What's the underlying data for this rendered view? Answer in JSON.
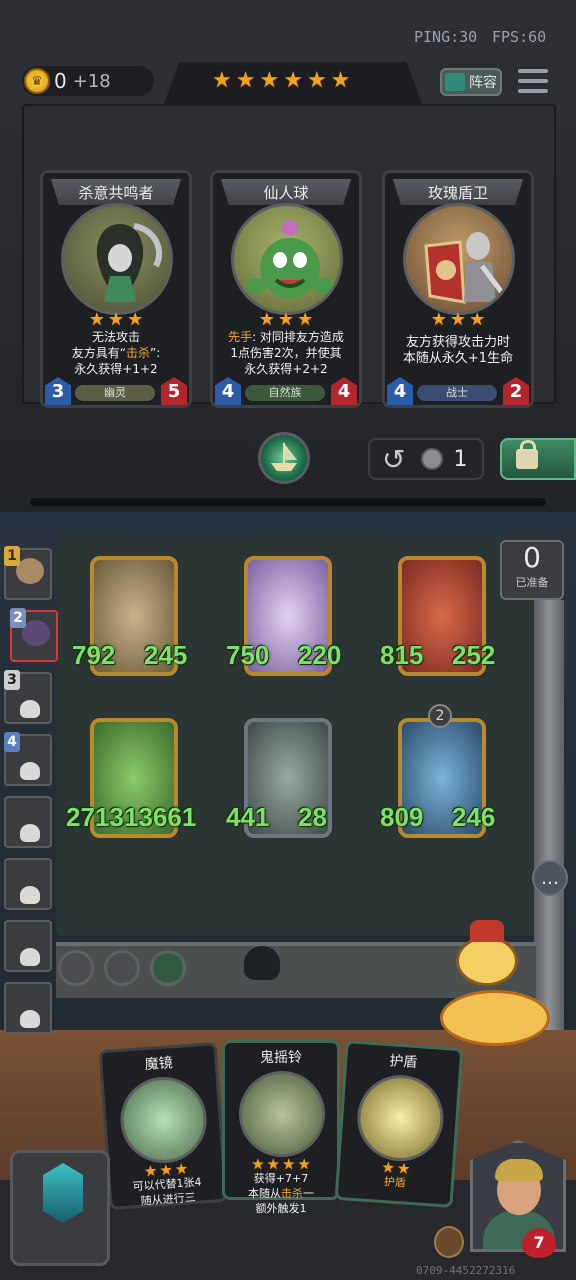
{
  "status": {
    "ping": "PING:30",
    "fps": "FPS:60"
  },
  "gold": {
    "value": "0",
    "income": "+18"
  },
  "tavern": {
    "tier_stars": 6
  },
  "lineup_button": "阵容",
  "shop": [
    {
      "name": "杀意共鸣者",
      "stars": 3,
      "text_parts": [
        "无法攻击",
        "友方具有“",
        "击杀",
        "”:",
        "永久获得+1+2"
      ],
      "tribe": "幽灵",
      "attack": "3",
      "health": "5"
    },
    {
      "name": "仙人球",
      "stars": 3,
      "text_parts": [
        "先手",
        ": 对同排友方造成",
        "1点伤害2次，并使其",
        "永久获得+2+2"
      ],
      "tribe": "自然族",
      "attack": "4",
      "health": "4"
    },
    {
      "name": "玫瑰盾卫",
      "stars": 3,
      "text_parts": [
        "友方获得攻击力时",
        "本随从永久+1生命"
      ],
      "tribe": "战士",
      "attack": "4",
      "health": "2"
    }
  ],
  "refresh": {
    "cost": "1"
  },
  "ready": {
    "count": "0",
    "label": "已准备"
  },
  "rankings": [
    {
      "rank": "1"
    },
    {
      "rank": "2"
    },
    {
      "rank": "3"
    },
    {
      "rank": "4"
    },
    {
      "rank": ""
    },
    {
      "rank": ""
    },
    {
      "rank": ""
    },
    {
      "rank": ""
    }
  ],
  "board": [
    {
      "attack": "792",
      "health": "245"
    },
    {
      "attack": "750",
      "health": "220"
    },
    {
      "attack": "815",
      "health": "252"
    },
    {
      "attack": "2713",
      "health": "13661"
    },
    {
      "attack": "441",
      "health": "28"
    },
    {
      "attack": "809",
      "health": "246",
      "badge": "2"
    }
  ],
  "hand": [
    {
      "name": "魔镜",
      "stars": 3,
      "text_parts": [
        "可以代替1张4",
        "随从进行三"
      ]
    },
    {
      "name": "鬼摇铃",
      "stars": 4,
      "text_parts": [
        "获得+7+7",
        "本随从",
        "击杀",
        "一",
        "额外触发1"
      ]
    },
    {
      "name": "护盾",
      "stars": 2,
      "text_parts": [
        "护盾"
      ]
    }
  ],
  "hero": {
    "health": "7"
  },
  "game_id": "0709-4452272316",
  "colors": {
    "star": "#f4a21c",
    "stat_green": "#7fe06b",
    "attack_badge": "#2a5caa",
    "health_badge": "#b3262e",
    "keyword": "#f0a43a"
  }
}
